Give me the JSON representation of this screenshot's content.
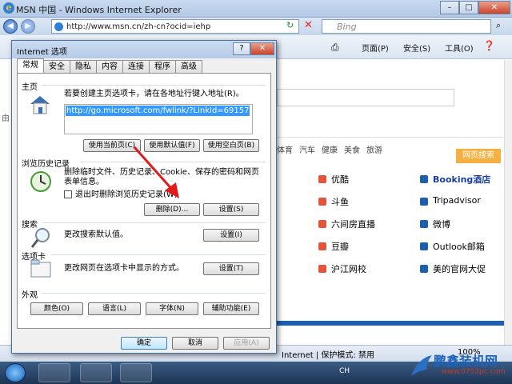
{
  "ie": {
    "title": "MSN 中国 - Windows Internet Explorer",
    "address": "http://www.msn.cn/zh-cn?ocid=iehp",
    "search_placeholder": "Bing",
    "cmd": {
      "page": "页面(P)",
      "safety": "安全(S)",
      "tools": "工具(O)"
    },
    "status_text": "Internet | 保护模式: 禁用",
    "zoom": "100%",
    "site_search_btn": "网页搜索",
    "bg_tabs": [
      "体育",
      "汽车",
      "健康",
      "美食",
      "旅游"
    ],
    "bg_edge_char": "由",
    "links_left": [
      "优酷",
      "斗鱼",
      "六间房直播",
      "豆瓣",
      "沪江网校"
    ],
    "links_right": [
      "Booking酒店",
      "Tripadvisor",
      "微博",
      "Outlook邮箱",
      "美的官网大促"
    ],
    "tray_lang": "CH"
  },
  "dialog": {
    "title": "Internet 选项",
    "tabs": [
      "常规",
      "安全",
      "隐私",
      "内容",
      "连接",
      "程序",
      "高级"
    ],
    "home": {
      "title": "主页",
      "desc": "若要创建主页选项卡，请在各地址行键入地址(R)。",
      "url": "http://go.microsoft.com/fwlink/?LinkId=69157",
      "btn_current": "使用当前页(C)",
      "btn_default": "使用默认值(F)",
      "btn_blank": "使用空白页(B)"
    },
    "history": {
      "title": "浏览历史记录",
      "desc1": "删除临时文件、历史记录、Cookie、保存的密码和网页",
      "desc2": "表单信息。",
      "checkbox": "退出时删除浏览历史记录(W)",
      "btn_delete": "删除(D)...",
      "btn_settings": "设置(S)"
    },
    "search": {
      "title": "搜索",
      "desc": "更改搜索默认值。",
      "btn_settings": "设置(I)"
    },
    "tabs_section": {
      "title": "选项卡",
      "desc": "更改网页在选项卡中显示的方式。",
      "btn_settings": "设置(T)"
    },
    "appearance": {
      "title": "外观",
      "btn_colors": "颜色(O)",
      "btn_languages": "语言(L)",
      "btn_fonts": "字体(N)",
      "btn_accessibility": "辅助功能(E)"
    },
    "ok": "确定",
    "cancel": "取消",
    "apply": "应用(A)"
  },
  "watermark": {
    "title": "鹏鑫装机网",
    "url": "www.0753pc.com"
  },
  "colors": {
    "accent": "#3399ff",
    "arrow": "#e01b1b"
  }
}
